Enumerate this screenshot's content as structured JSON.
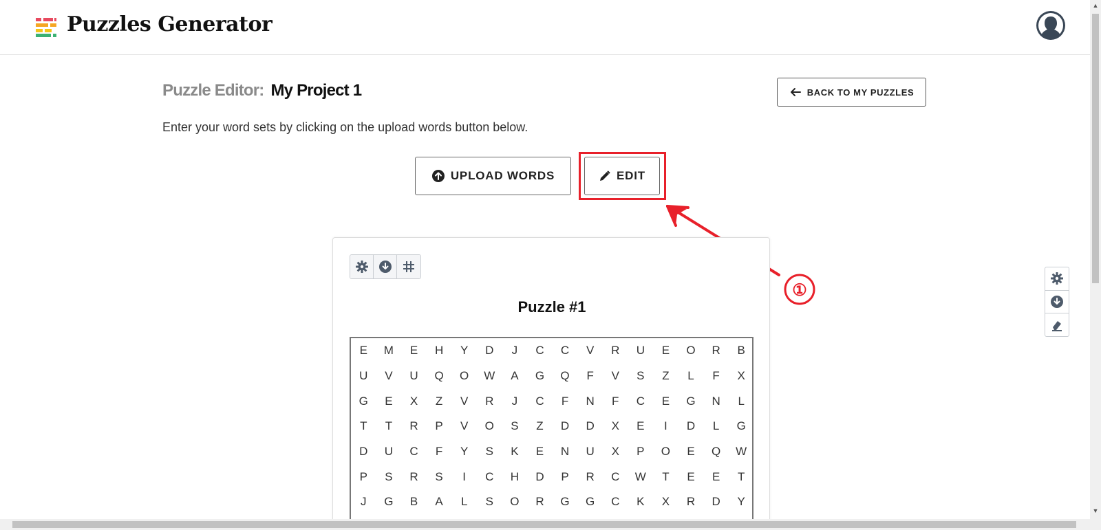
{
  "header": {
    "brand": "Puzzles Generator",
    "logo_icon": "puzzles-logo-icon",
    "avatar_icon": "user-avatar-icon"
  },
  "editor": {
    "title_label": "Puzzle Editor:",
    "project_name": "My Project 1",
    "back_label": "BACK TO MY PUZZLES",
    "subtitle": "Enter your word sets by clicking on the upload words button below.",
    "upload_label": "UPLOAD WORDS",
    "edit_label": "EDIT"
  },
  "annotation": {
    "marker": "①",
    "color": "#e8202a"
  },
  "puzzle": {
    "title": "Puzzle #1",
    "toolbar_icons": [
      "gear-icon",
      "download-icon",
      "grid-icon"
    ],
    "rows": [
      [
        "E",
        "M",
        "E",
        "H",
        "Y",
        "D",
        "J",
        "C",
        "C",
        "V",
        "R",
        "U",
        "E",
        "O",
        "R",
        "B"
      ],
      [
        "U",
        "V",
        "U",
        "Q",
        "O",
        "W",
        "A",
        "G",
        "Q",
        "F",
        "V",
        "S",
        "Z",
        "L",
        "F",
        "X"
      ],
      [
        "G",
        "E",
        "X",
        "Z",
        "V",
        "R",
        "J",
        "C",
        "F",
        "N",
        "F",
        "C",
        "E",
        "G",
        "N",
        "L"
      ],
      [
        "T",
        "T",
        "R",
        "P",
        "V",
        "O",
        "S",
        "Z",
        "D",
        "D",
        "X",
        "E",
        "I",
        "D",
        "L",
        "G"
      ],
      [
        "D",
        "U",
        "C",
        "F",
        "Y",
        "S",
        "K",
        "E",
        "N",
        "U",
        "X",
        "P",
        "O",
        "E",
        "Q",
        "W"
      ],
      [
        "P",
        "S",
        "R",
        "S",
        "I",
        "C",
        "H",
        "D",
        "P",
        "R",
        "C",
        "W",
        "T",
        "E",
        "E",
        "T"
      ],
      [
        "J",
        "G",
        "B",
        "A",
        "L",
        "S",
        "O",
        "R",
        "G",
        "G",
        "C",
        "K",
        "X",
        "R",
        "D",
        "Y"
      ]
    ]
  },
  "side_tools": [
    "gear-icon",
    "download-icon",
    "eraser-icon"
  ],
  "colors": {
    "accent_red": "#e8202a",
    "icon_slate": "#4e5b6b"
  }
}
